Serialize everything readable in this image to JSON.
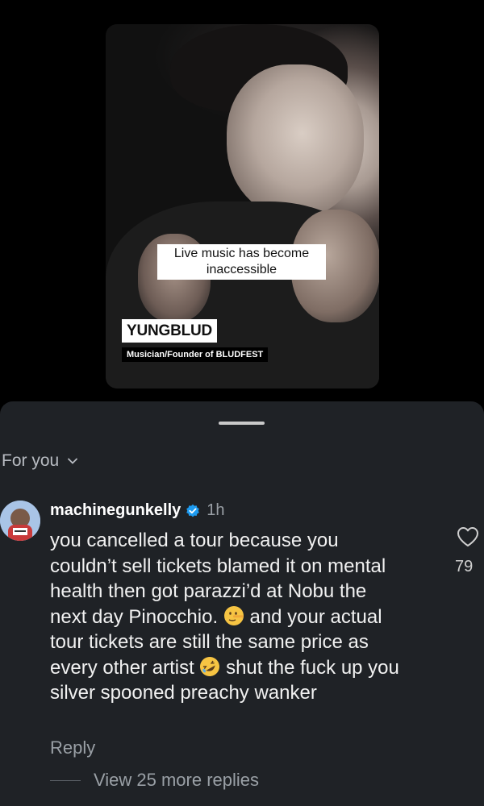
{
  "video": {
    "caption": "Live music has become inaccessible",
    "speaker_name": "YUNGBLUD",
    "speaker_role": "Musician/Founder of BLUDFEST"
  },
  "comments_header": {
    "filter_label": "For you"
  },
  "comment": {
    "username": "machinegunkelly",
    "verified": true,
    "time": "1h",
    "text_part1": "you cancelled a tour because you couldn’t sell tickets blamed it on mental health then got parazzi’d at Nobu the next day Pinocchio. ",
    "emoji1": "lying-face",
    "text_part2": " and your actual tour tickets are still the same price as every other artist ",
    "emoji2": "rolling-on-floor-laughing",
    "text_part3": " shut the fuck up you silver spooned preachy wanker",
    "like_count": "79",
    "reply_label": "Reply",
    "view_replies_label": "View 25 more replies"
  },
  "colors": {
    "sheet_background": "#1f2226",
    "muted_text": "#9aa0a6",
    "verified_blue": "#1d9bf0"
  }
}
